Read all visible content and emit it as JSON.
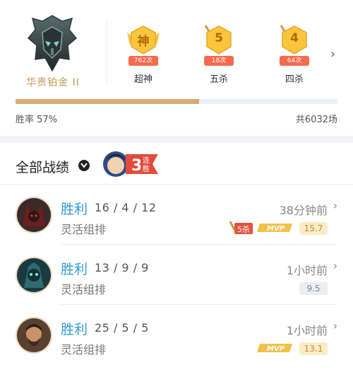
{
  "rank": {
    "name": "华贵铂金 II"
  },
  "honors": [
    {
      "glyph": "神",
      "count": "762次",
      "label": "超神"
    },
    {
      "glyph": "5",
      "count": "18次",
      "label": "五杀"
    },
    {
      "glyph": "4",
      "count": "64次",
      "label": "四杀"
    }
  ],
  "stats": {
    "win_rate_text": "胜率 57%",
    "win_rate": 0.57,
    "total_text": "共6032场"
  },
  "filter": {
    "label": "全部战绩"
  },
  "streak": {
    "number": "3",
    "text_top": "连",
    "text_bottom": "胜"
  },
  "matches": [
    {
      "result": "胜利",
      "kda": "16 / 4 / 12",
      "mode": "灵活组排",
      "time": "38分钟前",
      "score": "15.7",
      "score_style": "gold",
      "mvp": true,
      "multikill": "5杀"
    },
    {
      "result": "胜利",
      "kda": "13 / 9 / 9",
      "mode": "灵活组排",
      "time": "1小时前",
      "score": "9.5",
      "score_style": "gray",
      "mvp": false,
      "multikill": ""
    },
    {
      "result": "胜利",
      "kda": "25 / 5 / 5",
      "mode": "灵活组排",
      "time": "1小时前",
      "score": "13.1",
      "score_style": "gold",
      "mvp": true,
      "multikill": ""
    }
  ],
  "badges": {
    "mvp_text": "MVP"
  },
  "colors": {
    "gold": "#d4ac72",
    "win_blue": "#2f9bd5",
    "medal_yellow": "#f9c53d",
    "count_red": "#f46b4f"
  }
}
